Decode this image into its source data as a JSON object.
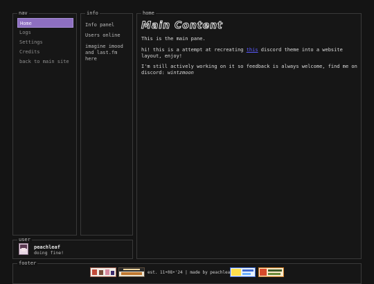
{
  "nav": {
    "legend": "nav",
    "items": [
      {
        "label": "Home"
      },
      {
        "label": "Logs"
      },
      {
        "label": "Settings"
      },
      {
        "label": "Credits"
      },
      {
        "label": "back to main site"
      }
    ],
    "active_color": "#8d6fc0"
  },
  "info": {
    "legend": "info",
    "items": [
      {
        "label": "Info panel"
      },
      {
        "label": "Users online"
      },
      {
        "label": "imagine imood and last.fm here"
      }
    ]
  },
  "home": {
    "legend": "home",
    "title": "Main Content",
    "p1": "This is the main pane.",
    "p2_before": "hi! this is a attempt at recreating ",
    "p2_link": "this",
    "p2_after": " discord theme into a website layout, enjoy!",
    "p3_before": "I'm still actively working on it so feedback is always welcome, find me on discord: ",
    "p3_em": "wintzmoon",
    "link_color": "#5b5bff"
  },
  "user": {
    "legend": "user",
    "name": "peachleaf",
    "status": "doing fine!"
  },
  "footer": {
    "legend": "footer",
    "text": "est. 11•08•'24 | made by peachleaf"
  }
}
